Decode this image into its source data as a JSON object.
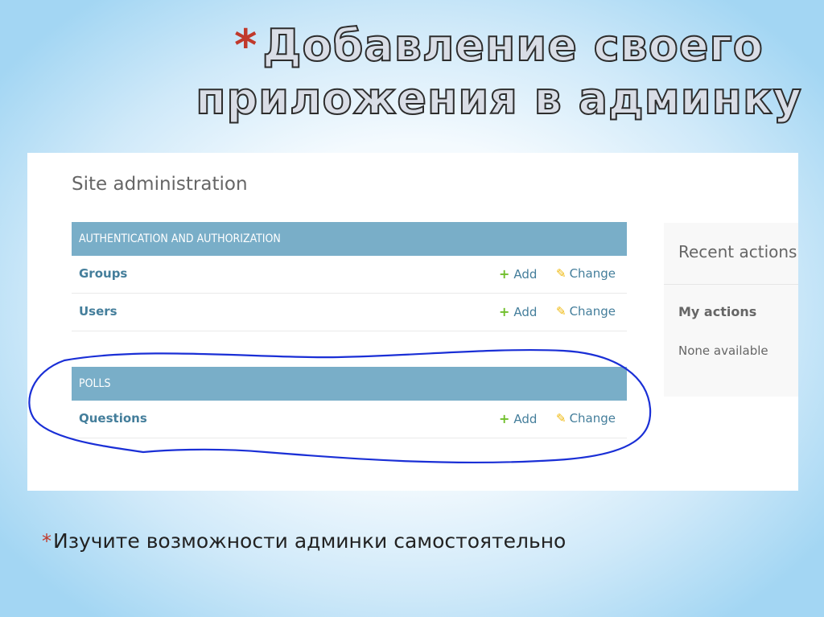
{
  "slide": {
    "title_bullet": "*",
    "title": "Добавление своего приложения в админку",
    "footer_bullet": "*",
    "footer_text": "Изучите возможности админки самостоятельно"
  },
  "admin": {
    "site_title": "Site administration",
    "modules": [
      {
        "caption": "AUTHENTICATION AND AUTHORIZATION",
        "models": [
          {
            "name": "Groups",
            "add_label": "Add",
            "change_label": "Change"
          },
          {
            "name": "Users",
            "add_label": "Add",
            "change_label": "Change"
          }
        ]
      },
      {
        "caption": "POLLS",
        "models": [
          {
            "name": "Questions",
            "add_label": "Add",
            "change_label": "Change"
          }
        ]
      }
    ],
    "recent_actions": {
      "title": "Recent actions",
      "my_actions": "My actions",
      "empty_text": "None available"
    },
    "icons": {
      "add": "plus-icon",
      "change": "pencil-icon"
    }
  },
  "colors": {
    "module_caption_bg": "#79aec8",
    "link": "#447e9b",
    "add_icon": "#70bf2b",
    "change_icon": "#efb80b",
    "annotation_ink": "#1a2fd6",
    "bullet": "#c0392b"
  }
}
